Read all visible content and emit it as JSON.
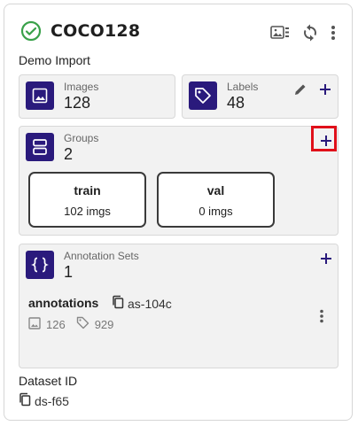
{
  "header": {
    "title": "COCO128",
    "subtitle": "Demo Import",
    "status_icon": "check-circle-icon",
    "status_color": "#3aa14a"
  },
  "stats": {
    "images": {
      "label": "Images",
      "value": "128",
      "icon": "image-icon"
    },
    "labels": {
      "label": "Labels",
      "value": "48",
      "icon": "tag-icon"
    }
  },
  "groups": {
    "label": "Groups",
    "count": "2",
    "icon": "groups-icon",
    "items": [
      {
        "name": "train",
        "count": "102 imgs"
      },
      {
        "name": "val",
        "count": "0 imgs"
      }
    ]
  },
  "annotation_sets": {
    "label": "Annotation Sets",
    "count": "1",
    "icon": "braces-icon",
    "items": [
      {
        "name": "annotations",
        "id": "as-104c",
        "images": "126",
        "labels": "929"
      }
    ]
  },
  "dataset": {
    "id_label": "Dataset ID",
    "id": "ds-f65"
  },
  "colors": {
    "accent": "#2a1a7c",
    "highlight": "#e0101a",
    "tile_bg": "#f2f2f2"
  }
}
